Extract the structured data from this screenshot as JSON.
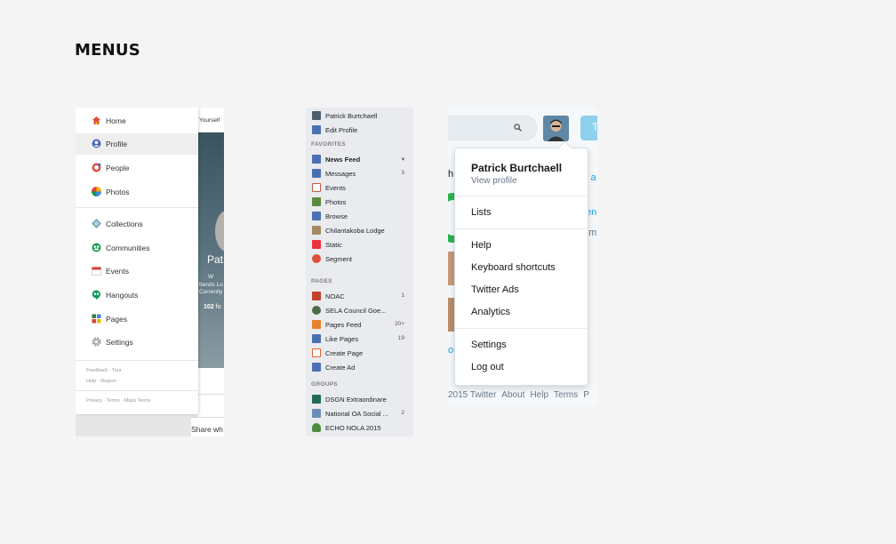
{
  "page": {
    "title": "MENUS"
  },
  "gplus": {
    "top_hint": "Yourself",
    "profile_name": "Pat",
    "profile_lines": [
      "W",
      "ttends Lo",
      "Currently"
    ],
    "follow_count": "102",
    "follow_suffix": "fo",
    "share_text": "Share wh",
    "items": [
      {
        "label": "Home",
        "icon": "home-icon",
        "color": "#e04b3d"
      },
      {
        "label": "Profile",
        "icon": "profile-icon",
        "color": "#4e6cb7"
      },
      {
        "label": "People",
        "icon": "people-icon",
        "color": "#e04b3d"
      },
      {
        "label": "Photos",
        "icon": "photos-icon",
        "color": "#f4b400"
      },
      {
        "label": "Collections",
        "icon": "collections-icon",
        "color": "#7aa6b5"
      },
      {
        "label": "Communities",
        "icon": "communities-icon",
        "color": "#1a9b50"
      },
      {
        "label": "Events",
        "icon": "events-icon",
        "color": "#d94436"
      },
      {
        "label": "Hangouts",
        "icon": "hangouts-icon",
        "color": "#0f9d58"
      },
      {
        "label": "Pages",
        "icon": "pages-icon",
        "color": "#3c7b3f"
      },
      {
        "label": "Settings",
        "icon": "settings-icon",
        "color": "#9a9a9a"
      }
    ],
    "footer_row1": [
      "Feedback",
      "Tour"
    ],
    "footer_row2": [
      "Help",
      "Region"
    ],
    "footer_row3": [
      "Privacy",
      "Terms",
      "Maps Terms"
    ]
  },
  "facebook": {
    "profile": [
      {
        "label": "Patrick Burtchaell",
        "icon": "avatar-icon",
        "color": "#4b5d6e",
        "count": ""
      },
      {
        "label": "Edit Profile",
        "icon": "pencil-icon",
        "color": "#4b6fb3",
        "count": ""
      }
    ],
    "favorites_heading": "FAVORITES",
    "favorites": [
      {
        "label": "News Feed",
        "icon": "news-feed-icon",
        "color": "#4b6fb3",
        "count": "▾",
        "bold": true
      },
      {
        "label": "Messages",
        "icon": "messages-icon",
        "color": "#4b6fb3",
        "count": "3"
      },
      {
        "label": "Events",
        "icon": "calendar-icon",
        "color": "#c75a4a",
        "count": ""
      },
      {
        "label": "Photos",
        "icon": "photos-icon",
        "color": "#5b8a3c",
        "count": ""
      },
      {
        "label": "Browse",
        "icon": "browse-icon",
        "color": "#4b6fb3",
        "count": ""
      },
      {
        "label": "Chilantakoba Lodge",
        "icon": "lodge-icon",
        "color": "#a58960",
        "count": ""
      },
      {
        "label": "Static",
        "icon": "static-icon",
        "color": "#e8343c",
        "count": ""
      },
      {
        "label": "Segment",
        "icon": "segment-icon",
        "color": "#e04f3b",
        "count": ""
      }
    ],
    "pages_heading": "PAGES",
    "pages": [
      {
        "label": "NOAC",
        "icon": "noac-icon",
        "color": "#c2402e",
        "count": "1"
      },
      {
        "label": "SELA Council Goe...",
        "icon": "globe-icon",
        "color": "#4d6b47",
        "count": ""
      },
      {
        "label": "Pages Feed",
        "icon": "megaphone-icon",
        "color": "#e8822d",
        "count": "20+"
      },
      {
        "label": "Like Pages",
        "icon": "thumbs-up-icon",
        "color": "#4b6fb3",
        "count": "19"
      },
      {
        "label": "Create Page",
        "icon": "create-page-icon",
        "color": "#e8622d",
        "count": ""
      },
      {
        "label": "Create Ad",
        "icon": "chart-icon",
        "color": "#4b6fb3",
        "count": ""
      }
    ],
    "groups_heading": "GROUPS",
    "groups": [
      {
        "label": "DSGN Extraordinare",
        "icon": "group-icon",
        "color": "#1f6b52",
        "count": ""
      },
      {
        "label": "National OA Social ...",
        "icon": "megaphone-icon",
        "color": "#6c8db8",
        "count": "2"
      },
      {
        "label": "ECHO NOLA 2015",
        "icon": "tree-icon",
        "color": "#4f8b3b",
        "count": ""
      }
    ]
  },
  "twitter": {
    "tweet_label": "T",
    "bg_fragments": [
      "h",
      "y a",
      "ten",
      "om",
      "g",
      "ou"
    ],
    "footer_links": [
      "2015 Twitter",
      "About",
      "Help",
      "Terms",
      "P"
    ],
    "menu": {
      "name": "Patrick Burtchaell",
      "view_profile": "View profile",
      "lists": "Lists",
      "help": "Help",
      "shortcuts": "Keyboard shortcuts",
      "ads": "Twitter Ads",
      "analytics": "Analytics",
      "settings": "Settings",
      "logout": "Log out"
    }
  }
}
